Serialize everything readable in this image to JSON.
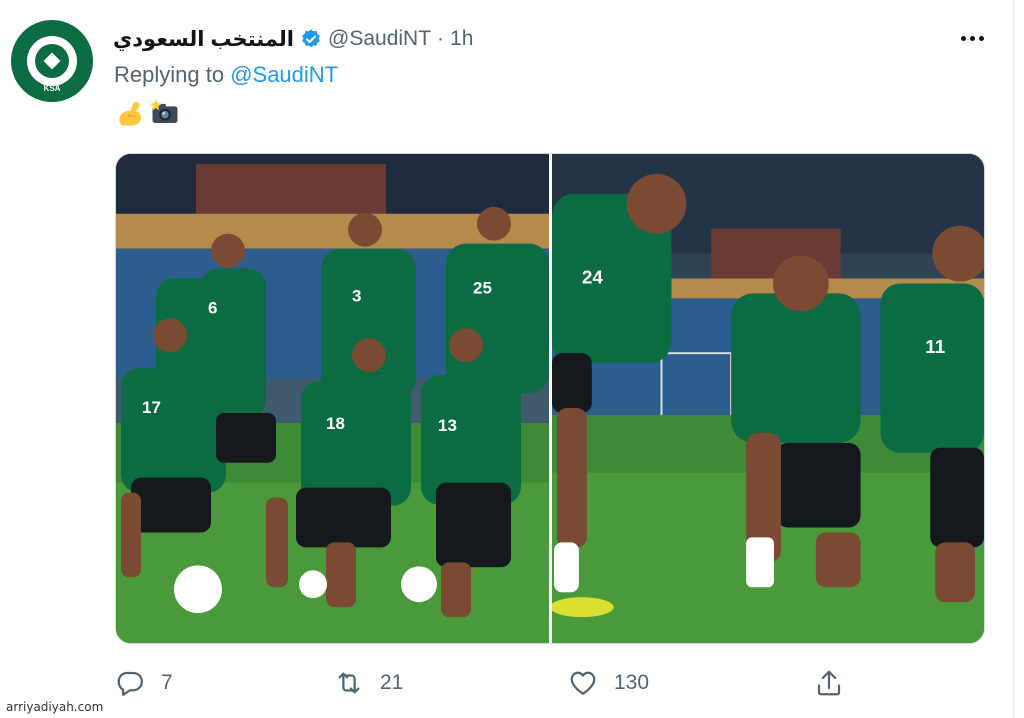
{
  "tweet": {
    "display_name": "المنتخب السعودي",
    "handle": "@SaudiNT",
    "separator": "·",
    "time": "1h",
    "replying_prefix": "Replying to ",
    "replying_to": "@SaudiNT",
    "emojis": [
      "flexed-biceps",
      "camera-with-flash"
    ],
    "avatar_text": "KSA"
  },
  "photos": {
    "left": {
      "jersey_numbers": [
        "6",
        "3",
        "25",
        "17",
        "18",
        "13"
      ]
    },
    "right": {
      "jersey_numbers": [
        "24",
        "11"
      ]
    }
  },
  "actions": {
    "replies": "7",
    "retweets": "21",
    "likes": "130"
  },
  "watermark": "arriyadiyah.com",
  "colors": {
    "link": "#1d9bf0",
    "secondary_text": "#536471",
    "verified": "#1d9bf0",
    "jersey_green": "#0b6b43"
  }
}
